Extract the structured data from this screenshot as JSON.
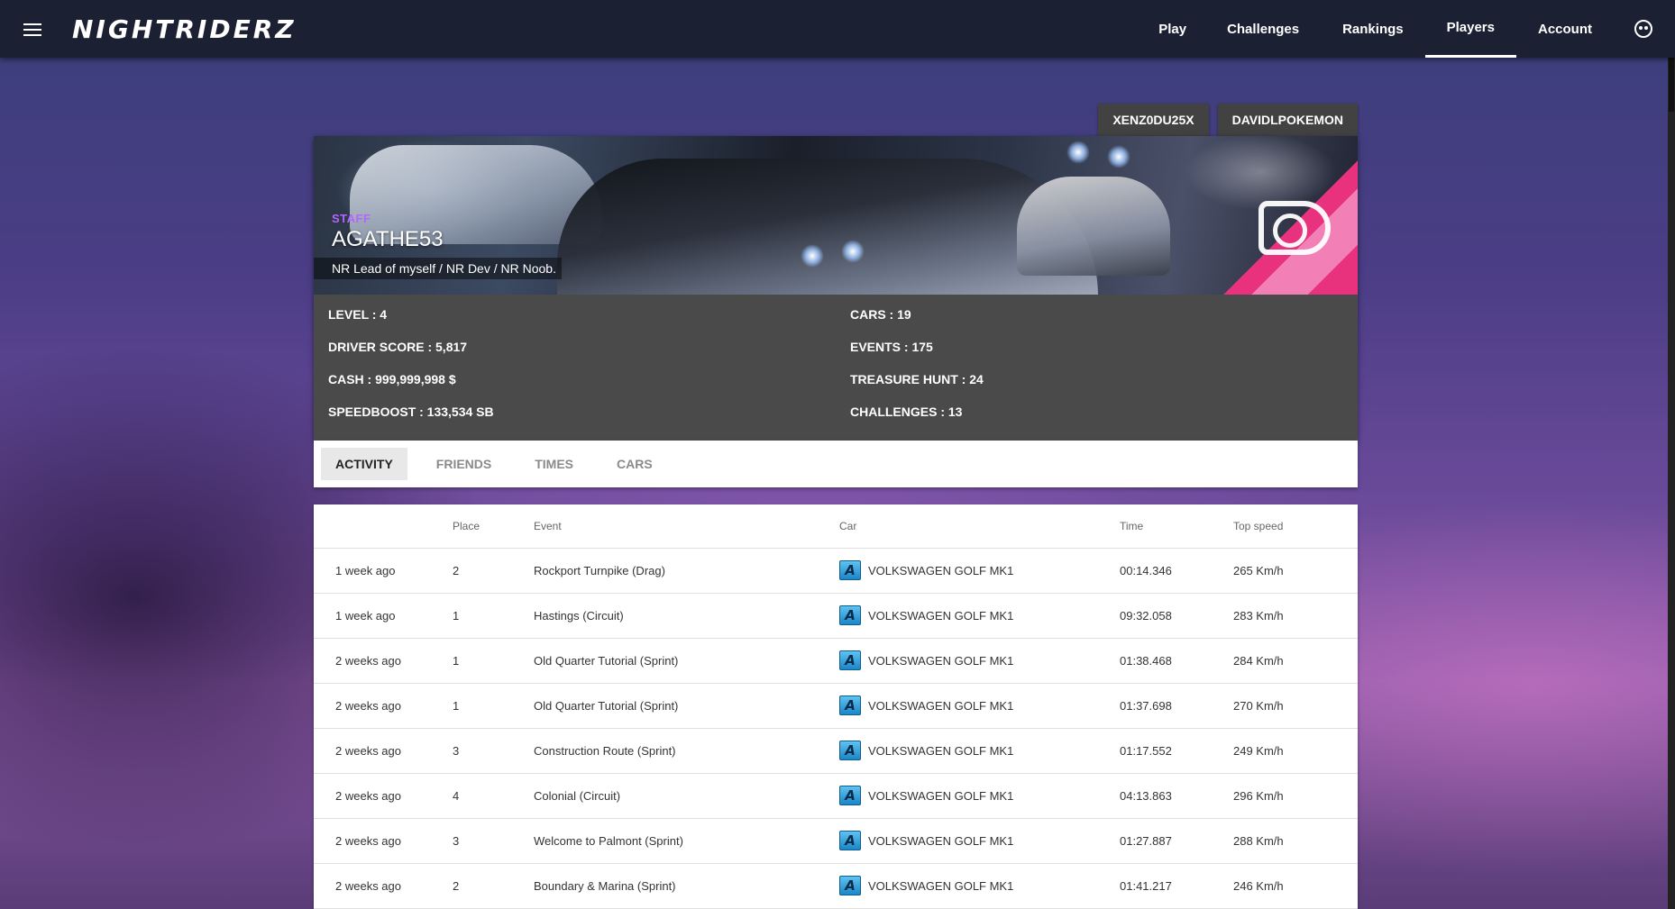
{
  "app": {
    "logo": "NIGHTRIDERZ"
  },
  "nav": {
    "items": [
      {
        "label": "Play",
        "active": false
      },
      {
        "label": "Challenges",
        "active": false
      },
      {
        "label": "Rankings",
        "active": false
      },
      {
        "label": "Players",
        "active": true
      },
      {
        "label": "Account",
        "active": false
      }
    ]
  },
  "profile_tabs": [
    "XENZ0DU25X",
    "DAVIDLPOKEMON"
  ],
  "player": {
    "role": "STAFF",
    "name": "AGATHE53",
    "motto": "NR Lead of myself / NR Dev / NR Noob."
  },
  "stats": {
    "level": "LEVEL : 4",
    "cars": "CARS : 19",
    "driver_score": "DRIVER SCORE : 5,817",
    "events": "EVENTS : 175",
    "cash": "CASH : 999,999,998 $",
    "treasure_hunt": "TREASURE HUNT : 24",
    "speedboost": "SPEEDBOOST : 133,534 SB",
    "challenges": "CHALLENGES : 13"
  },
  "tabs": [
    {
      "label": "ACTIVITY",
      "active": true
    },
    {
      "label": "FRIENDS",
      "active": false
    },
    {
      "label": "TIMES",
      "active": false
    },
    {
      "label": "CARS",
      "active": false
    }
  ],
  "table": {
    "headers": {
      "when": "",
      "place": "Place",
      "event": "Event",
      "car": "Car",
      "time": "Time",
      "speed": "Top speed"
    },
    "rows": [
      {
        "when": "1 week ago",
        "place": "2",
        "event": "Rockport Turnpike (Drag)",
        "car_class": "A",
        "car": "VOLKSWAGEN GOLF MK1",
        "time": "00:14.346",
        "speed": "265 Km/h"
      },
      {
        "when": "1 week ago",
        "place": "1",
        "event": "Hastings (Circuit)",
        "car_class": "A",
        "car": "VOLKSWAGEN GOLF MK1",
        "time": "09:32.058",
        "speed": "283 Km/h"
      },
      {
        "when": "2 weeks ago",
        "place": "1",
        "event": "Old Quarter Tutorial (Sprint)",
        "car_class": "A",
        "car": "VOLKSWAGEN GOLF MK1",
        "time": "01:38.468",
        "speed": "284 Km/h"
      },
      {
        "when": "2 weeks ago",
        "place": "1",
        "event": "Old Quarter Tutorial (Sprint)",
        "car_class": "A",
        "car": "VOLKSWAGEN GOLF MK1",
        "time": "01:37.698",
        "speed": "270 Km/h"
      },
      {
        "when": "2 weeks ago",
        "place": "3",
        "event": "Construction Route (Sprint)",
        "car_class": "A",
        "car": "VOLKSWAGEN GOLF MK1",
        "time": "01:17.552",
        "speed": "249 Km/h"
      },
      {
        "when": "2 weeks ago",
        "place": "4",
        "event": "Colonial (Circuit)",
        "car_class": "A",
        "car": "VOLKSWAGEN GOLF MK1",
        "time": "04:13.863",
        "speed": "296 Km/h"
      },
      {
        "when": "2 weeks ago",
        "place": "3",
        "event": "Welcome to Palmont (Sprint)",
        "car_class": "A",
        "car": "VOLKSWAGEN GOLF MK1",
        "time": "01:27.887",
        "speed": "288 Km/h"
      },
      {
        "when": "2 weeks ago",
        "place": "2",
        "event": "Boundary & Marina (Sprint)",
        "car_class": "A",
        "car": "VOLKSWAGEN GOLF MK1",
        "time": "01:41.217",
        "speed": "246 Km/h"
      }
    ]
  },
  "icons": {
    "menu": "menu-icon",
    "avatar": "avatar-icon",
    "car_class": "class-a-icon"
  },
  "colors": {
    "topbar": "#1c2033",
    "staff": "#b266ff",
    "card": "#4a4a4a",
    "class_badge": "#3aa6e0"
  }
}
